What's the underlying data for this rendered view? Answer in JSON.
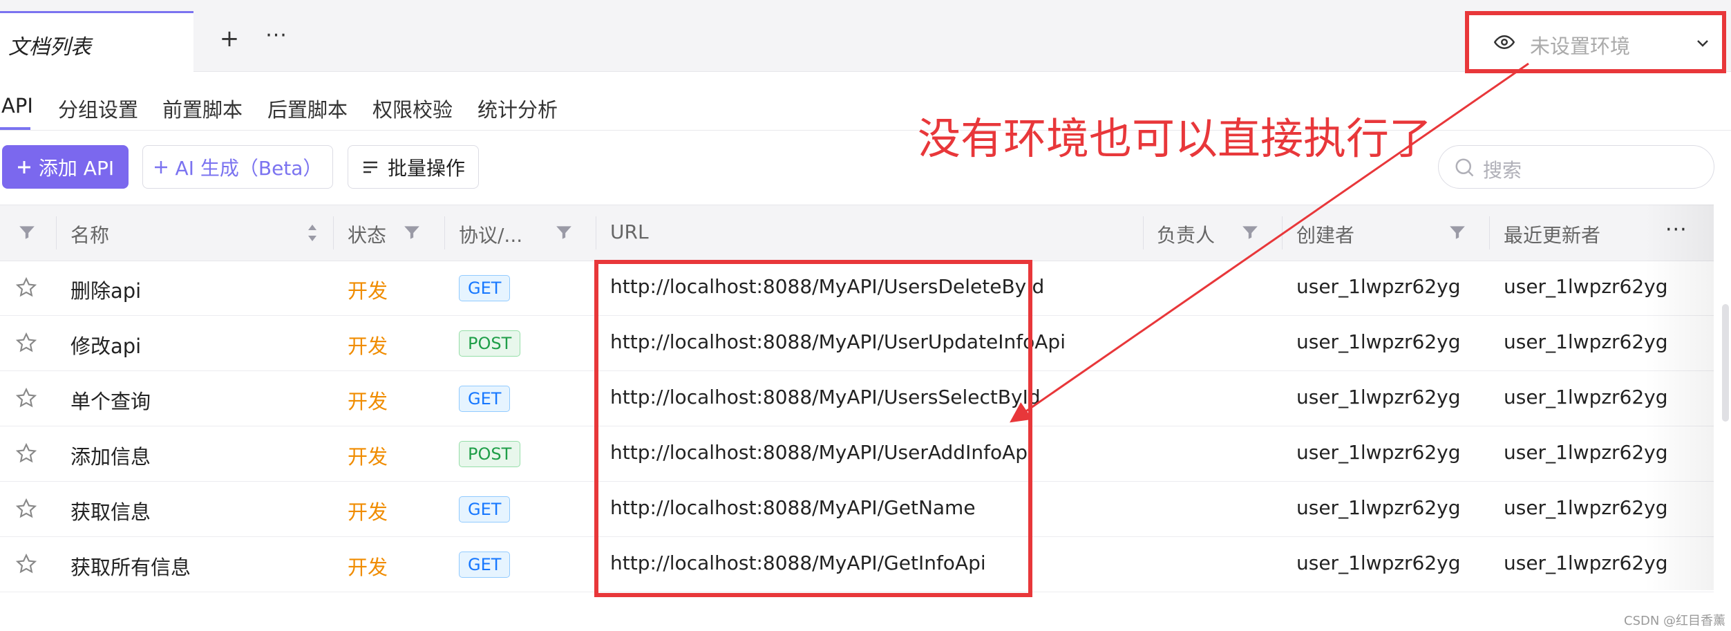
{
  "top_tabs": {
    "doc_list_label": "文档列表",
    "add_symbol": "+",
    "more_symbol": "···"
  },
  "environment": {
    "placeholder": "未设置环境",
    "icon": "eye-icon",
    "chevron": "chevron-down-icon"
  },
  "sub_tabs": [
    "API",
    "分组设置",
    "前置脚本",
    "后置脚本",
    "权限校验",
    "统计分析"
  ],
  "toolbar": {
    "add_api_label": "添加 API",
    "ai_label": "AI 生成（Beta）",
    "batch_label": "批量操作",
    "search_placeholder": "搜索"
  },
  "annotation": "没有环境也可以直接执行了",
  "table": {
    "headers": {
      "name": "名称",
      "status": "状态",
      "protocol": "协议/...",
      "url": "URL",
      "owner": "负责人",
      "creator": "创建者",
      "updater": "最近更新者",
      "more": "···"
    },
    "rows": [
      {
        "name": "删除api",
        "status": "开发",
        "method": "GET",
        "url": "http://localhost:8088/MyAPI/UsersDeleteById",
        "creator": "user_1lwpzr62yg",
        "updater": "user_1lwpzr62yg"
      },
      {
        "name": "修改api",
        "status": "开发",
        "method": "POST",
        "url": "http://localhost:8088/MyAPI/UserUpdateInfoApi",
        "creator": "user_1lwpzr62yg",
        "updater": "user_1lwpzr62yg"
      },
      {
        "name": "单个查询",
        "status": "开发",
        "method": "GET",
        "url": "http://localhost:8088/MyAPI/UsersSelectById",
        "creator": "user_1lwpzr62yg",
        "updater": "user_1lwpzr62yg"
      },
      {
        "name": "添加信息",
        "status": "开发",
        "method": "POST",
        "url": "http://localhost:8088/MyAPI/UserAddInfoApi",
        "creator": "user_1lwpzr62yg",
        "updater": "user_1lwpzr62yg"
      },
      {
        "name": "获取信息",
        "status": "开发",
        "method": "GET",
        "url": "http://localhost:8088/MyAPI/GetName",
        "creator": "user_1lwpzr62yg",
        "updater": "user_1lwpzr62yg"
      },
      {
        "name": "获取所有信息",
        "status": "开发",
        "method": "GET",
        "url": "http://localhost:8088/MyAPI/GetInfoApi",
        "creator": "user_1lwpzr62yg",
        "updater": "user_1lwpzr62yg"
      }
    ]
  },
  "watermark": "CSDN @红目香薰",
  "colors": {
    "accent": "#7b68ee",
    "annotation_red": "#e8373a",
    "status_dev": "#f08c00",
    "get_blue": "#1677ff",
    "post_green": "#1f9e48"
  }
}
